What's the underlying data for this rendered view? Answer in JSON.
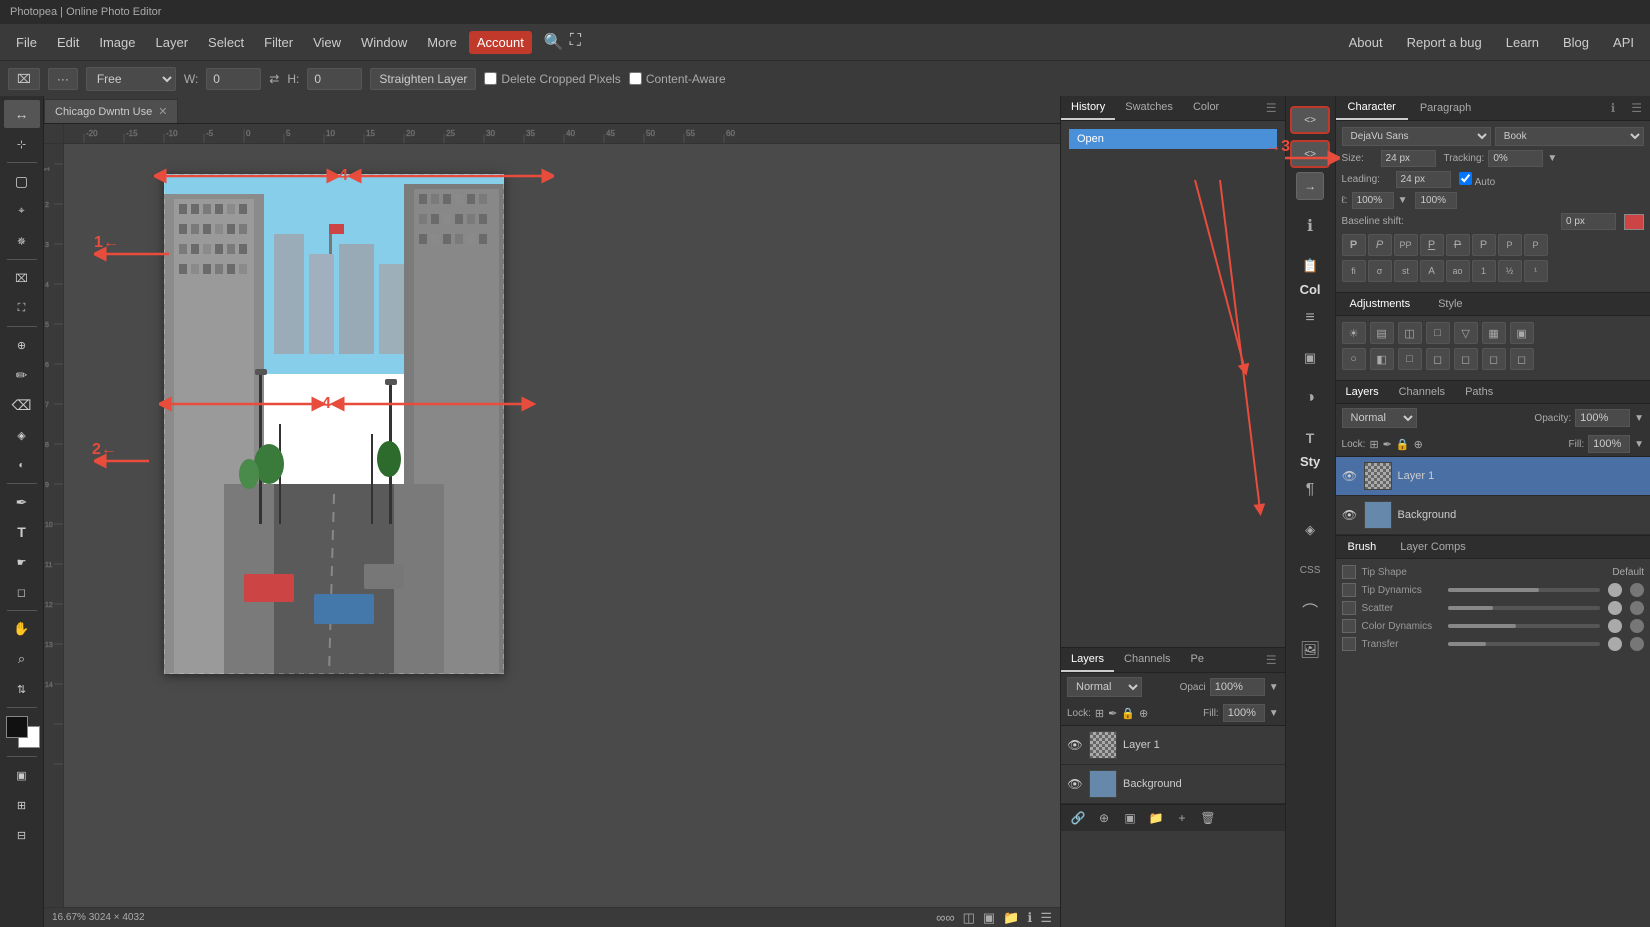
{
  "app": {
    "title": "Photopea | Online Photo Editor"
  },
  "menu": {
    "items": [
      {
        "label": "File",
        "id": "file"
      },
      {
        "label": "Edit",
        "id": "edit"
      },
      {
        "label": "Image",
        "id": "image"
      },
      {
        "label": "Layer",
        "id": "layer"
      },
      {
        "label": "Select",
        "id": "select"
      },
      {
        "label": "Filter",
        "id": "filter"
      },
      {
        "label": "View",
        "id": "view"
      },
      {
        "label": "Window",
        "id": "window"
      },
      {
        "label": "More",
        "id": "more"
      },
      {
        "label": "Account",
        "id": "account",
        "active": true
      }
    ],
    "right_items": [
      {
        "label": "About",
        "id": "about"
      },
      {
        "label": "Report a bug",
        "id": "report-bug"
      },
      {
        "label": "Learn",
        "id": "learn"
      },
      {
        "label": "Blog",
        "id": "blog"
      },
      {
        "label": "API",
        "id": "api"
      }
    ]
  },
  "toolbar": {
    "crop_icon": "⌧",
    "options_icon": "···",
    "transform_label": "Free",
    "w_label": "W:",
    "w_value": "0",
    "h_label": "H:",
    "h_value": "0",
    "straighten_label": "Straighten Layer",
    "delete_cropped_label": "Delete Cropped Pixels",
    "content_aware_label": "Content-Aware"
  },
  "canvas": {
    "tab_name": "Chicago Dwntn Use",
    "status": "16.67%  3024 × 4032",
    "zoom": "16.67%",
    "dimensions": "3024 × 4032"
  },
  "history_panel": {
    "tabs": [
      "History",
      "Swatches",
      "Color"
    ],
    "active_tab": "History",
    "items": [
      {
        "label": "Open",
        "selected": true
      }
    ]
  },
  "layers_mid": {
    "tabs": [
      "Layers",
      "Channels",
      "Pe"
    ],
    "active_tab": "Layers",
    "blend_mode": "Normal",
    "opacity": "100%",
    "fill": "100%",
    "lock_label": "Lock:",
    "layers": [
      {
        "name": "Layer 1",
        "visible": true,
        "type": "checker",
        "selected": false
      },
      {
        "name": "Background",
        "visible": true,
        "type": "image",
        "selected": false
      }
    ]
  },
  "icon_panel": {
    "icons": [
      {
        "symbol": "ℹ",
        "name": "info"
      },
      {
        "symbol": "📋",
        "name": "document"
      },
      {
        "symbol": "T",
        "name": "text"
      },
      {
        "symbol": "¶",
        "name": "paragraph"
      },
      {
        "symbol": "≡",
        "name": "align"
      },
      {
        "symbol": "▣",
        "name": "transform"
      },
      {
        "symbol": "◑",
        "name": "contrast"
      },
      {
        "symbol": "T",
        "name": "text2"
      },
      {
        "symbol": "¶",
        "name": "para2"
      },
      {
        "symbol": "◎",
        "name": "circle-label",
        "label": "CSS"
      },
      {
        "symbol": "⌒",
        "name": "curve"
      },
      {
        "symbol": "🖼",
        "name": "image-preview"
      }
    ],
    "labels": {
      "col": "Col",
      "sty": "Sty",
      "css": "CSS"
    }
  },
  "char_panel": {
    "tabs": [
      "Character",
      "Paragraph"
    ],
    "active_tab": "Character",
    "font_family": "DejaVu Sans",
    "font_style": "Book",
    "size_label": "Size:",
    "size_value": "24 px",
    "tracking_label": "Tracking:",
    "tracking_value": "0%",
    "leading_label": "Leading:",
    "leading_value": "24 px",
    "auto_label": "Auto",
    "scale_h": "100%",
    "scale_v": "100%",
    "baseline_shift_label": "Baseline shift:",
    "baseline_shift_value": "0 px",
    "color_label": "Color"
  },
  "adj_panel": {
    "tabs": [
      "Adjustments",
      "Style"
    ],
    "active_tab": "Adjustments",
    "icons": [
      "☀",
      "▤",
      "◫",
      "□",
      "▽",
      "▦",
      "▣",
      "○",
      "◧",
      "□",
      "◻",
      "◻",
      "◻",
      "◻"
    ]
  },
  "right_layers": {
    "tabs": [
      "Layers",
      "Channels",
      "Paths"
    ],
    "active_tab": "Layers",
    "blend_mode": "Normal",
    "opacity": "100%",
    "fill": "100%",
    "lock_label": "Lock:",
    "layers": [
      {
        "name": "Layer 1",
        "visible": true,
        "type": "checker",
        "selected": true
      },
      {
        "name": "Background",
        "visible": true,
        "type": "image",
        "selected": false
      }
    ]
  },
  "brush_panel": {
    "tabs": [
      "Brush",
      "Layer Comps"
    ],
    "active_tab": "Brush",
    "tip_shape_label": "Tip Shape",
    "default_label": "Default",
    "rows": [
      {
        "label": "Tip Dynamics",
        "has_toggle": true,
        "fill_pct": 60
      },
      {
        "label": "Scatter",
        "has_toggle": true,
        "fill_pct": 30
      },
      {
        "label": "Color Dynamics",
        "has_toggle": true,
        "fill_pct": 45
      },
      {
        "label": "Transfer",
        "has_toggle": true,
        "fill_pct": 25
      }
    ]
  },
  "annotations": {
    "arrow1_label": "1←",
    "arrow2_label": "2←",
    "arrow3_label": "→3",
    "arrow4_label": "4"
  },
  "code_buttons": {
    "btn1": "<>",
    "btn2": "<>"
  },
  "tools": {
    "items": [
      {
        "symbol": "↔",
        "name": "move"
      },
      {
        "symbol": "⊹",
        "name": "artboard"
      },
      {
        "symbol": "▢",
        "name": "rect-select"
      },
      {
        "symbol": "⌖",
        "name": "lasso"
      },
      {
        "symbol": "✂",
        "name": "crop"
      },
      {
        "symbol": "⊿",
        "name": "slice"
      },
      {
        "symbol": "⛶",
        "name": "eyedropper"
      },
      {
        "symbol": "✒",
        "name": "pen"
      },
      {
        "symbol": "✏",
        "name": "brush"
      },
      {
        "symbol": "⌫",
        "name": "eraser"
      },
      {
        "symbol": "◈",
        "name": "stamp"
      },
      {
        "symbol": "◐",
        "name": "dodge"
      },
      {
        "symbol": "T",
        "name": "type"
      },
      {
        "symbol": "☛",
        "name": "path-select"
      },
      {
        "symbol": "✋",
        "name": "hand"
      },
      {
        "symbol": "⌕",
        "name": "zoom"
      },
      {
        "symbol": "⇅",
        "name": "ruler2"
      }
    ]
  }
}
